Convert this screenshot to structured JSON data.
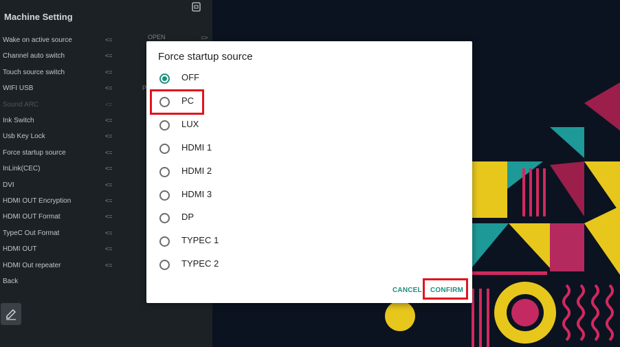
{
  "settings": {
    "title": "Machine Setting",
    "rows": [
      {
        "label": "Wake on active source",
        "arrow": "<=",
        "value": "OPEN",
        "arrow_right": "=>"
      },
      {
        "label": "Channel auto switch",
        "arrow": "<="
      },
      {
        "label": "Touch source switch",
        "arrow": "<="
      },
      {
        "label": "WIFI USB",
        "arrow": "<=",
        "value_partial": "P"
      },
      {
        "label": "Sound ARC",
        "arrow": "<=",
        "disabled": true
      },
      {
        "label": "Ink Switch",
        "arrow": "<="
      },
      {
        "label": "Usb Key Lock",
        "arrow": "<="
      },
      {
        "label": "Force startup source",
        "arrow": "<="
      },
      {
        "label": "InLink(CEC)",
        "arrow": "<="
      },
      {
        "label": "DVI",
        "arrow": "<="
      },
      {
        "label": "HDMI OUT Encryption",
        "arrow": "<="
      },
      {
        "label": "HDMI OUT Format",
        "arrow": "<="
      },
      {
        "label": "TypeC Out Format",
        "arrow": "<="
      },
      {
        "label": "HDMI OUT",
        "arrow": "<="
      },
      {
        "label": "HDMI Out repeater",
        "arrow": "<="
      },
      {
        "label": "Back",
        "arrow": ""
      }
    ],
    "top_icon": "screen-icon",
    "edit_icon": "pencil-icon"
  },
  "dialog": {
    "title": "Force startup source",
    "options": [
      {
        "label": "OFF",
        "checked": true
      },
      {
        "label": "PC",
        "checked": false
      },
      {
        "label": "LUX",
        "checked": false
      },
      {
        "label": "HDMI 1",
        "checked": false
      },
      {
        "label": "HDMI 2",
        "checked": false
      },
      {
        "label": "HDMI 3",
        "checked": false
      },
      {
        "label": "DP",
        "checked": false
      },
      {
        "label": "TYPEC 1",
        "checked": false
      },
      {
        "label": "TYPEC 2",
        "checked": false
      }
    ],
    "cancel_label": "CANCEL",
    "confirm_label": "CONFIRM"
  },
  "colors": {
    "accent": "#1e8e7e",
    "highlight": "#e0141c",
    "panel": "#1b2125"
  }
}
